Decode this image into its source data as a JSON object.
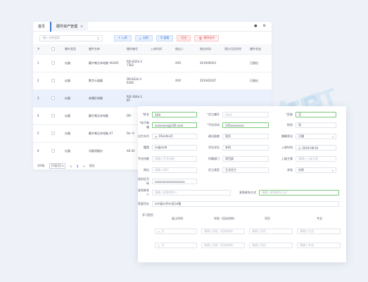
{
  "tabs": {
    "home": "首页",
    "active": "硬件资产管理",
    "close": "×"
  },
  "toolbar": {
    "search_placeholder": "输入名称搜索",
    "search_icon": "Q",
    "btn_add": "+ 入库",
    "btn_out": "出库",
    "btn_view": "Q 查看",
    "btn_return": "归还",
    "btn_delete": "删除选中"
  },
  "table": {
    "headers": [
      "#",
      "",
      "硬件类型",
      "硬件名称",
      "硬件编号",
      "入库时间",
      "借出人",
      "借出时间",
      "预计归还时间",
      "硬件状态"
    ],
    "rows": [
      {
        "n": "1",
        "type": "仪器",
        "name": "戴尔笔记本电脑 VH305",
        "code": "RJS-832k-2 7362",
        "in": "",
        "person": "XXX",
        "date": "2019/06/03",
        "ret": "",
        "status": "已借出"
      },
      {
        "n": "2",
        "type": "仪器",
        "name": "数字示波器",
        "code": "DR-832k-2 6362",
        "in": "",
        "person": "XXX",
        "date": "2019/02/07",
        "ret": "",
        "status": "已借出"
      },
      {
        "n": "3",
        "type": "仪器",
        "name": "安捷伦电磁",
        "code": "RJS-364k-2 81",
        "in": "",
        "person": "",
        "date": "",
        "ret": "",
        "status": ""
      },
      {
        "n": "4",
        "type": "仪器",
        "name": "戴尔笔记本电脑",
        "code": "DR-",
        "in": "",
        "person": "",
        "date": "",
        "ret": "",
        "status": ""
      },
      {
        "n": "5",
        "type": "仪器",
        "name": "戴尔笔记本电脑 47",
        "code": "De -0",
        "in": "",
        "person": "",
        "date": "",
        "ret": "",
        "status": ""
      },
      {
        "n": "6",
        "type": "仪器",
        "name": "功能测量仪",
        "code": "XE 02",
        "in": "",
        "person": "",
        "date": "",
        "ret": "",
        "status": ""
      }
    ]
  },
  "pager": {
    "total": "共9条",
    "size": "10条/页",
    "prev": "<",
    "page": "1",
    "next": ">",
    "goto": "前往"
  },
  "form": {
    "name_label": "姓名",
    "name_value": "XXX",
    "empno_label": "员工编号",
    "empno_placeholder": "0001",
    "ethnic_label": "民族",
    "ethnic_value": "汉",
    "email_label": "电子邮箱",
    "email_value": "xxxxxxxx@126.com",
    "phone_label": "手机号码",
    "phone_value": "135xxxxxxxx",
    "gender_label": "性别",
    "gender_value": "男",
    "birth_label": "出生年月",
    "birth_value": "19xx年x月",
    "origin_label": "政治面貌",
    "origin_value": "党员",
    "marriage_label": "婚姻状况",
    "marriage_value": "已婚",
    "native_label": "籍贯",
    "native_value": "xx省xx市",
    "edu_label": "学历学历",
    "edu_value": "本科",
    "join_label": "入职时间",
    "join_value": "2019-08-01",
    "major_label": "专业技能",
    "major_placeholder": "请输入专业技能",
    "dept_label": "所属部门",
    "dept_value": "项目部",
    "note_label": "上级主管",
    "note_placeholder": "请输入上级主管",
    "post_label": "岗位",
    "post_placeholder": "请输入岗位",
    "type_label": "员工类型",
    "type_value": "正式员工",
    "state_label": "状态",
    "state_value": "在职",
    "idcard_label": "身份证号码",
    "idcard_value": "xxxxxxxxxxxxxxxxxx",
    "contact_label": "紧急联系人",
    "contact_placeholder": "请输入紧急联系人",
    "contact_phone_label": "紧急联系方式",
    "contact_phone_placeholder": "请输入紧急联系方式",
    "address_label": "家庭住址",
    "address_value": "xxx省xx市xx区xx路",
    "study_label": "学习经历",
    "study_cols": [
      "起止时间",
      "学校（培训机构）",
      "学历",
      "专业"
    ],
    "study_rows": [
      {
        "date": "日",
        "school": "请输入学校（培训机构）",
        "degree": "请输入学历",
        "major": "请输入专业"
      },
      {
        "date": "日",
        "school": "请输入学校（培训机构）",
        "degree": "请输入学历",
        "major": "请输入专业"
      }
    ],
    "date_sep": "-"
  }
}
